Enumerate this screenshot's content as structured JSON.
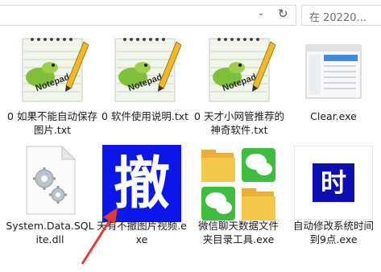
{
  "toolbar": {
    "search_placeholder": "在 20220..."
  },
  "files": [
    {
      "name": "0 如果不能自动保存图片.txt",
      "type": "txt"
    },
    {
      "name": "0 软件使用说明.txt",
      "type": "txt"
    },
    {
      "name": "0 天才小网管推荐的神奇软件.txt",
      "type": "txt"
    },
    {
      "name": "Clear.exe",
      "type": "exe"
    },
    {
      "name": "System.Data.SQLite.dll",
      "type": "dll"
    },
    {
      "name": "天有不撤图片视频.exe",
      "type": "exe",
      "icon_char": "撤"
    },
    {
      "name": "微信聊天数据文件夹目录工具.exe",
      "type": "exe"
    },
    {
      "name": "自动修改系统时间到9点.exe",
      "type": "exe",
      "icon_char": "时"
    }
  ],
  "colors": {
    "che_bg": "#0b16e8",
    "shi_bg": "#0d0fb3",
    "arrow": "#e53935",
    "wechat_green": "#3fbd3f",
    "folder_yellow": "#f3c84a"
  }
}
